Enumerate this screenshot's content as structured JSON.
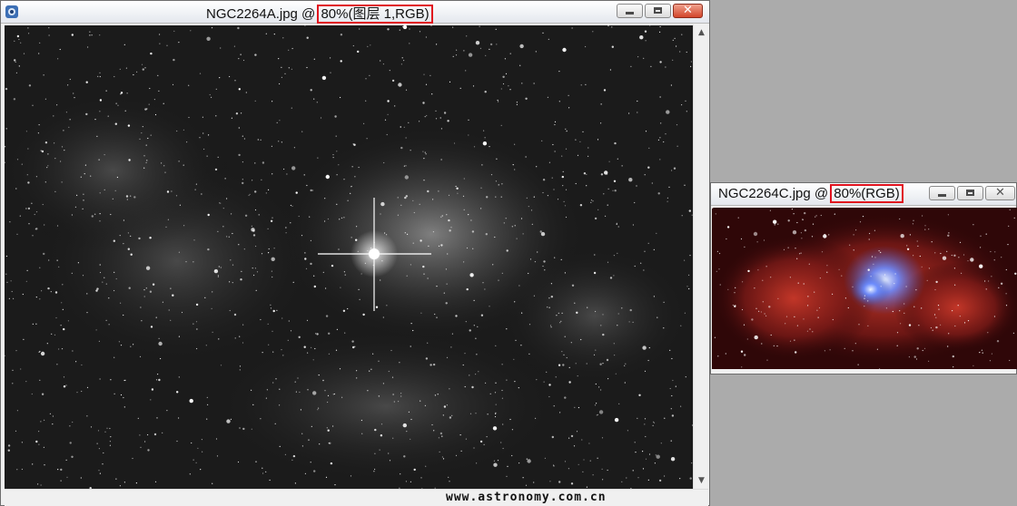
{
  "window_a": {
    "filename": "NGC2264A.jpg @ ",
    "zoom_label": "80%(图层 1,RGB)",
    "min_icon": "minimize-icon",
    "max_icon": "maximize-icon",
    "close_icon": "close-icon",
    "close_glyph": "✕",
    "scroll_up_glyph": "▲",
    "scroll_down_glyph": "▼",
    "watermark": "www.astronomy.com.cn",
    "image_desc_colors": [
      "#000000",
      "#ffffff"
    ]
  },
  "window_c": {
    "filename": "NGC2264C.jpg @ ",
    "zoom_label": "80%(RGB)",
    "close_glyph": "✕",
    "image_colors": [
      "#3b0a0c",
      "#b62b22",
      "#6b8cff"
    ]
  },
  "colors": {
    "highlight": "#e0121e",
    "desktop": "#ababab"
  }
}
